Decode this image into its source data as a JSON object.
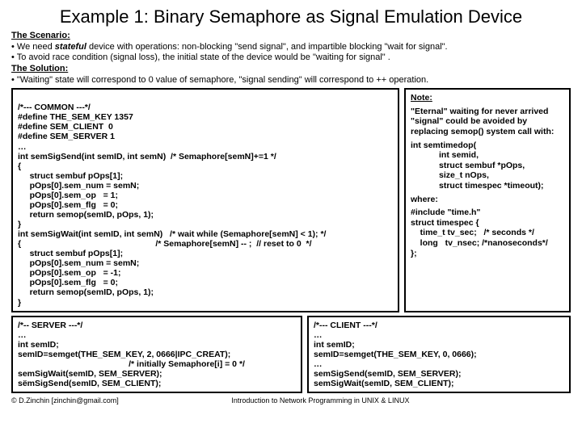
{
  "title": "Example 1: Binary Semaphore as Signal Emulation Device",
  "scenario_hdr": "The Scenario:",
  "scenario_1_a": "• We need ",
  "scenario_1_em": "stateful",
  "scenario_1_b": " device with operations: non-blocking \"send signal\", and impartible blocking \"wait for signal\".",
  "scenario_2": "• To avoid race condition (signal loss), the initial state of the device would  be \"waiting for signal\" .",
  "solution_hdr": "The Solution:",
  "solution_1": "• \"Waiting\" state will correspond to 0 value of semaphore, \"signal sending\" will correspond to ++ operation.",
  "common_code": "/*--- COMMON ---*/\n#define THE_SEM_KEY 1357\n#define SEM_CLIENT  0\n#define SEM_SERVER 1\n…\nint semSigSend(int semID, int semN)  /* Semaphore[semN]+=1 */\n{\n     struct sembuf pOps[1];\n     pOps[0].sem_num = semN;\n     pOps[0].sem_op   = 1;\n     pOps[0].sem_flg   = 0;\n     return semop(semID, pOps, 1);\n}",
  "wait_code": "int semSigWait(int semID, int semN)   /* wait while (Semaphore[semN] < 1); */\n{                                                         /* Semaphore[semN] -- ;  // reset to 0  */\n     struct sembuf pOps[1];\n     pOps[0].sem_num = semN;\n     pOps[0].sem_op   = -1;\n     pOps[0].sem_flg   = 0;\n     return semop(semID, pOps, 1);\n}",
  "note_hdr": "Note:",
  "note_p1": "\"Eternal\" waiting for never arrived \"signal\" could be avoided by replacing semop() system call with:",
  "note_code1": "int semtimedop(\n            int semid,\n            struct sembuf *pOps,\n            size_t nOps,\n            struct timespec *timeout);",
  "note_where": "where:",
  "note_code2": "#include \"time.h\"\nstruct timespec {\n    time_t tv_sec;   /* seconds */\n    long   tv_nsec; /*nanoseconds*/\n};",
  "server_code": "/*-- SERVER ---*/\n…\nint semID;\nsemID=semget(THE_SEM_KEY, 2, 0666|IPC_CREAT);\n                                               /* initially Semaphore[i] = 0 */\nsemSigWait(semID, SEM_SERVER);\nsëmSigSend(semID, SEM_CLIENT);",
  "client_code": "/*--- CLIENT ---*/\n…\nint semID;\nsemID=semget(THE_SEM_KEY, 0, 0666);\n…\nsemSigSend(semID, SEM_SERVER);\nsemSigWait(semID, SEM_CLIENT);",
  "footer_left": "© D.Zinchin [zinchin@gmail.com]",
  "footer_mid": "Introduction to Network Programming in UNIX & LINUX"
}
